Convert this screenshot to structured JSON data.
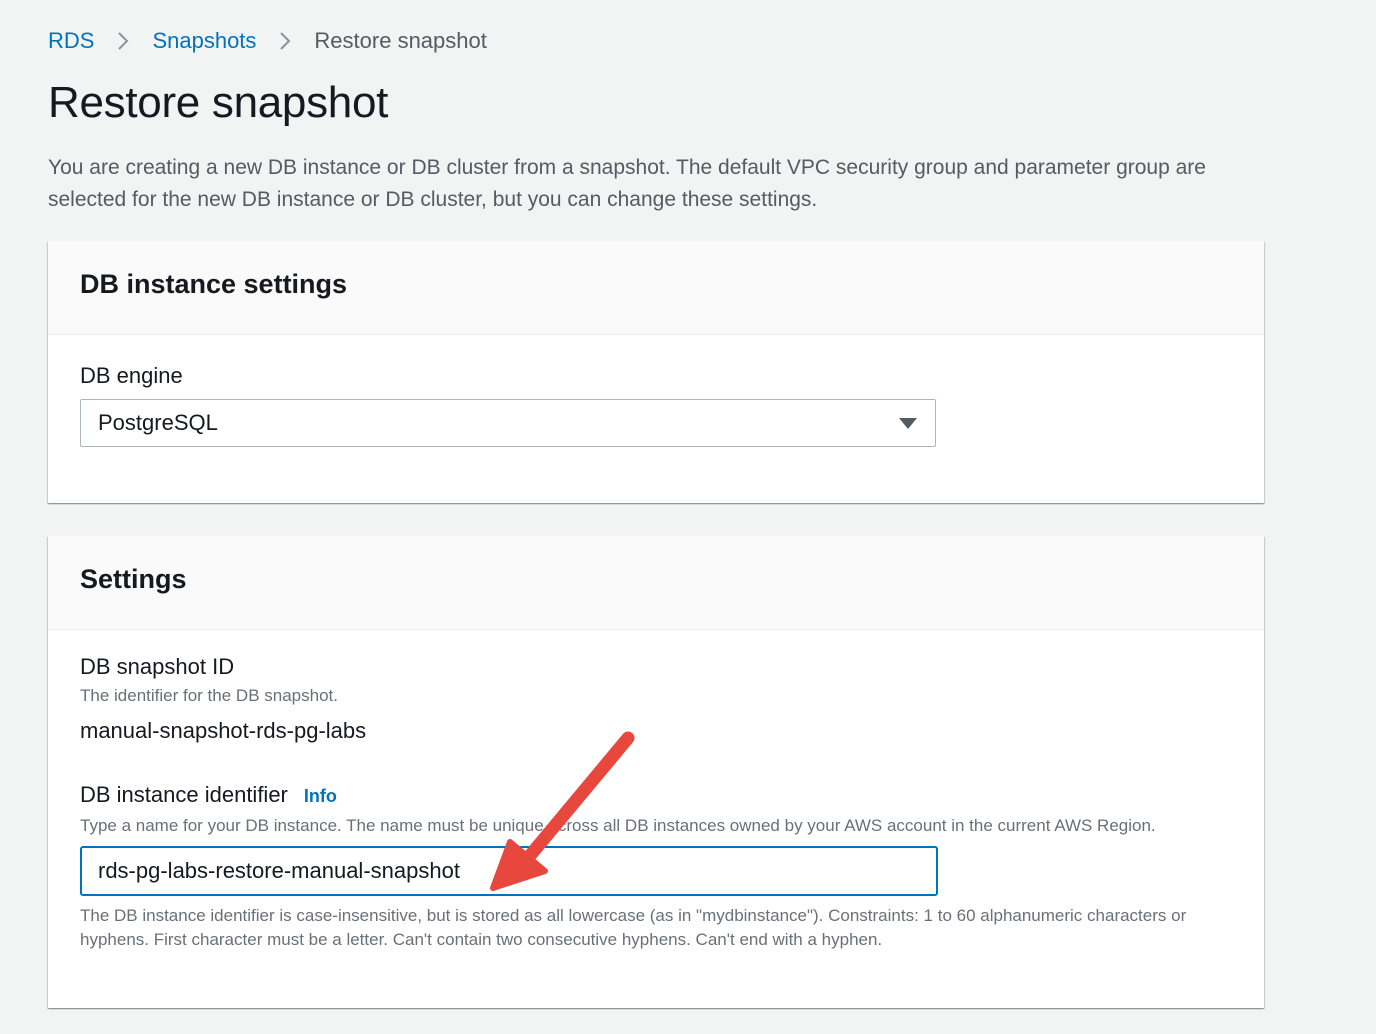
{
  "breadcrumb": {
    "items": [
      "RDS",
      "Snapshots"
    ],
    "current": "Restore snapshot"
  },
  "page": {
    "title": "Restore snapshot",
    "description": "You are creating a new DB instance or DB cluster from a snapshot. The default VPC security group and parameter group are selected for the new DB instance or DB cluster, but you can change these settings."
  },
  "db_instance_settings": {
    "heading": "DB instance settings",
    "engine_label": "DB engine",
    "engine_value": "PostgreSQL"
  },
  "settings": {
    "heading": "Settings",
    "snapshot_id_label": "DB snapshot ID",
    "snapshot_id_desc": "The identifier for the DB snapshot.",
    "snapshot_id_value": "manual-snapshot-rds-pg-labs",
    "instance_identifier_label": "DB instance identifier",
    "info_link": "Info",
    "instance_identifier_desc": "Type a name for your DB instance. The name must be unique across all DB instances owned by your AWS account in the current AWS Region.",
    "instance_identifier_value": "rds-pg-labs-restore-manual-snapshot",
    "instance_identifier_constraint": "The DB instance identifier is case-insensitive, but is stored as all lowercase (as in \"mydbinstance\"). Constraints: 1 to 60 alphanumeric characters or hyphens. First character must be a letter. Can't contain two consecutive hyphens. Can't end with a hyphen."
  },
  "colors": {
    "link": "#0073bb",
    "annotation_arrow": "#e8473d",
    "background": "#f2f3f3"
  }
}
